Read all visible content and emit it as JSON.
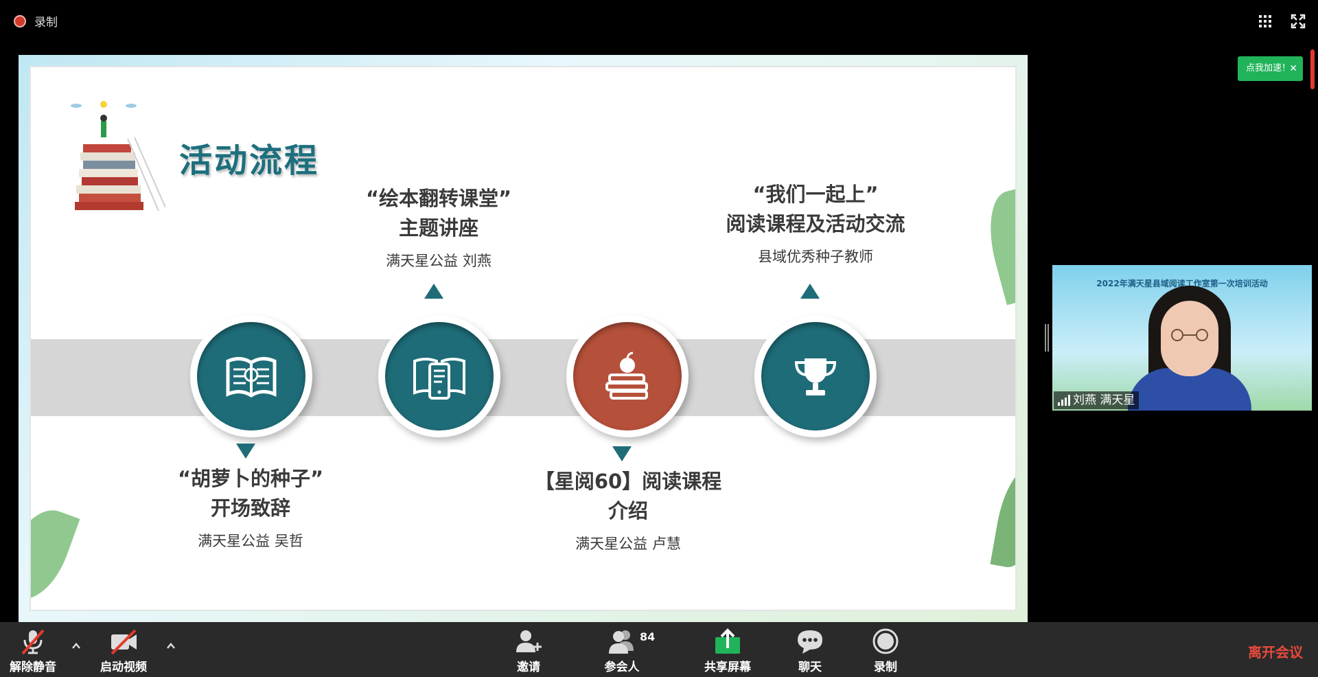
{
  "topbar": {
    "record_label": "录制",
    "colors": {
      "record_dot": "#d23a2a"
    }
  },
  "slide": {
    "title": "活动流程",
    "items": [
      {
        "title_line1": "“胡萝卜的种子”",
        "title_line2": "开场致辞",
        "speaker": "满天星公益  吴哲",
        "icon": "open-book-icon",
        "color": "#1e6c78"
      },
      {
        "title_line1": "“绘本翻转课堂”",
        "title_line2": "主题讲座",
        "speaker": "满天星公益  刘燕",
        "icon": "book-phone-icon",
        "color": "#1e6c78"
      },
      {
        "title_line1": "【星阅60】阅读课程",
        "title_line2": "介绍",
        "speaker": "满天星公益  卢慧",
        "icon": "books-apple-icon",
        "color": "#b5503a"
      },
      {
        "title_line1": "“我们一起上”",
        "title_line2": "阅读课程及活动交流",
        "speaker": "县域优秀种子教师",
        "icon": "trophy-icon",
        "color": "#1e6c78"
      }
    ]
  },
  "side": {
    "toast": "点我加速！",
    "video_title": "2022年满天星县域阅读工作室第一次培训活动",
    "participant_name": "刘燕 满天星"
  },
  "toolbar": {
    "mute": "解除静音",
    "video": "启动视频",
    "invite": "邀请",
    "participants": "参会人",
    "participant_count": "84",
    "share": "共享屏幕",
    "chat": "聊天",
    "record": "录制",
    "leave": "离开会议",
    "colors": {
      "leave": "#e84a3b",
      "share": "#21b35a"
    }
  }
}
